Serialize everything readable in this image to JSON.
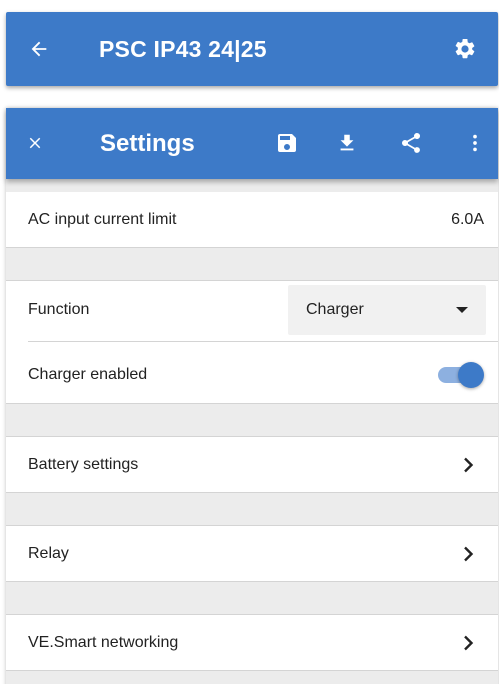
{
  "appbar": {
    "title": "PSC IP43 24|25",
    "back_icon": "arrow-left-icon",
    "settings_icon": "gear-icon"
  },
  "settings_panel": {
    "title": "Settings",
    "toolbar_icons": [
      "close-icon",
      "save-icon",
      "download-icon",
      "share-icon",
      "more-vertical-icon"
    ]
  },
  "rows": {
    "ac_limit": {
      "label": "AC input current limit",
      "value": "6.0A"
    },
    "function": {
      "label": "Function",
      "selected": "Charger"
    },
    "charger_enabled": {
      "label": "Charger enabled",
      "enabled": true
    },
    "battery": {
      "label": "Battery settings"
    },
    "relay": {
      "label": "Relay"
    },
    "networking": {
      "label": "VE.Smart networking"
    }
  },
  "colors": {
    "primary": "#3d7ac8",
    "background": "#ececec",
    "row": "#ffffff"
  }
}
